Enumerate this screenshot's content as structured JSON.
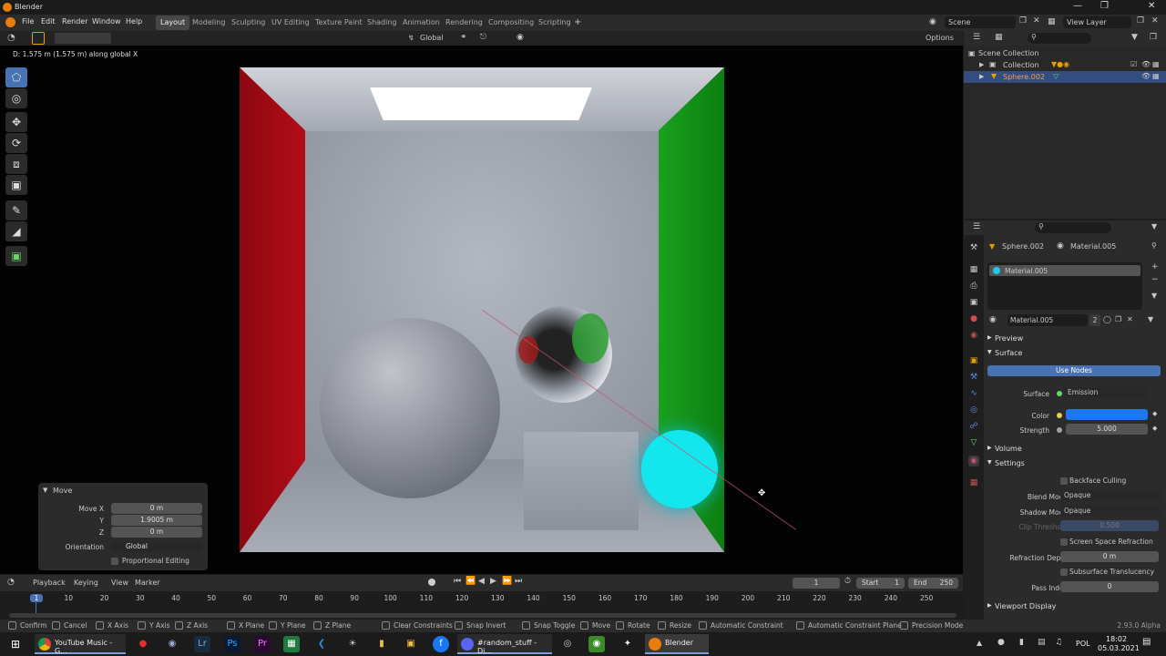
{
  "app": {
    "title": "Blender"
  },
  "menu": [
    "File",
    "Edit",
    "Render",
    "Window",
    "Help"
  ],
  "workspaces": [
    "Layout",
    "Modeling",
    "Sculpting",
    "UV Editing",
    "Texture Paint",
    "Shading",
    "Animation",
    "Rendering",
    "Compositing",
    "Scripting"
  ],
  "active_workspace": "Layout",
  "scene": {
    "name": "Scene",
    "view_layer": "View Layer"
  },
  "viewport": {
    "header": {
      "orientation": "Global",
      "options": "Options"
    },
    "hint": "D: 1.575 m (1.575 m) along global X"
  },
  "tools": [
    "select-box",
    "cursor",
    "move",
    "rotate",
    "scale",
    "transform",
    "annotate",
    "measure",
    "add-cube"
  ],
  "move_panel": {
    "title": "Move",
    "move_x_label": "Move X",
    "move_x": "0 m",
    "y_label": "Y",
    "y": "1.9005 m",
    "z_label": "Z",
    "z": "0 m",
    "orientation_label": "Orientation",
    "orientation": "Global",
    "proportional": "Proportional Editing"
  },
  "timeline": {
    "menus": [
      "Playback",
      "Keying",
      "View",
      "Marker"
    ],
    "current_frame": "1",
    "start_label": "Start",
    "start": "1",
    "end_label": "End",
    "end": "250",
    "ruler": [
      "1",
      "10",
      "20",
      "30",
      "40",
      "50",
      "60",
      "70",
      "80",
      "90",
      "100",
      "110",
      "120",
      "130",
      "140",
      "150",
      "160",
      "170",
      "180",
      "190",
      "200",
      "210",
      "220",
      "230",
      "240",
      "250"
    ]
  },
  "statusbar": {
    "items": [
      "Confirm",
      "Cancel",
      "X Axis",
      "Y Axis",
      "Z Axis",
      "X Plane",
      "Y Plane",
      "Z Plane",
      "Clear Constraints",
      "Snap Invert",
      "Snap Toggle",
      "Move",
      "Rotate",
      "Resize",
      "Automatic Constraint",
      "Automatic Constraint Plane",
      "Precision Mode"
    ],
    "version": "2.93.0 Alpha"
  },
  "outliner": {
    "root": "Scene Collection",
    "collection": "Collection",
    "selected_object": "Sphere.002"
  },
  "properties": {
    "object": "Sphere.002",
    "material_header": "Material.005",
    "slot": "Material.005",
    "material_name": "Material.005",
    "users": "2",
    "preview": "Preview",
    "surface_section": "Surface",
    "use_nodes": "Use Nodes",
    "surface_label": "Surface",
    "surface_value": "Emission",
    "color_label": "Color",
    "color_hex": "#1b78f0",
    "strength_label": "Strength",
    "strength": "5.000",
    "volume": "Volume",
    "settings": "Settings",
    "backface": "Backface Culling",
    "blend_label": "Blend Mode",
    "blend": "Opaque",
    "shadow_label": "Shadow Mode",
    "shadow": "Opaque",
    "clip_label": "Clip Threshold",
    "clip": "0.500",
    "ssr": "Screen Space Refraction",
    "refr_label": "Refraction Depth",
    "refr": "0 m",
    "sss": "Subsurface Translucency",
    "pass_label": "Pass Index",
    "pass": "0",
    "viewport_display": "Viewport Display"
  },
  "taskbar": {
    "chrome_label": "YouTube Music - G...",
    "discord_label": "#random_stuff - Di...",
    "blender_label": "Blender",
    "lang": "POL",
    "time": "18:02",
    "date": "05.03.2021"
  }
}
